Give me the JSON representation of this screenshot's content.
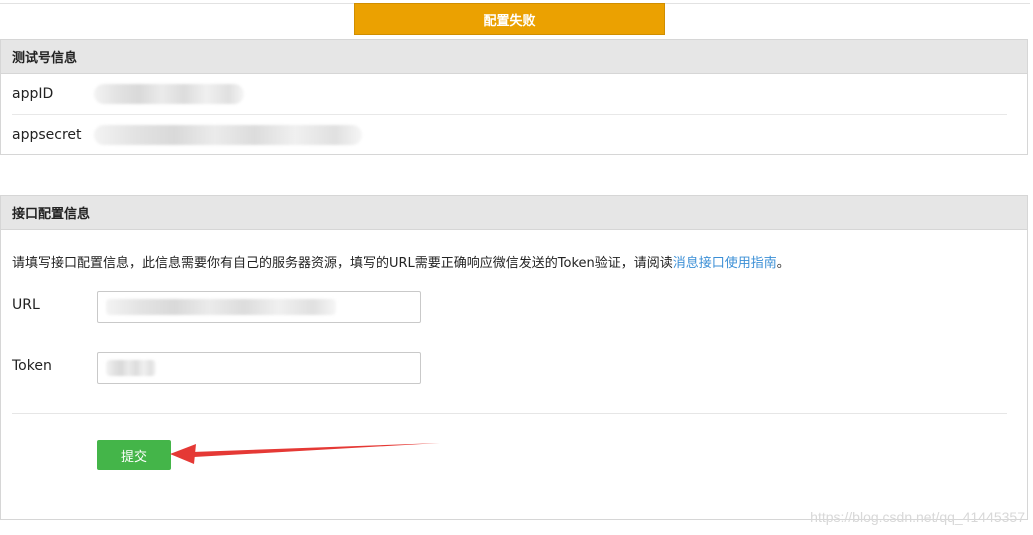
{
  "alert": {
    "text": "配置失败",
    "color": "#eba101"
  },
  "test_account": {
    "title": "测试号信息",
    "appid_label": "appID",
    "appsecret_label": "appsecret"
  },
  "interface_config": {
    "title": "接口配置信息",
    "description": "请填写接口配置信息，此信息需要你有自己的服务器资源，填写的URL需要正确响应微信发送的Token验证，请阅读",
    "doc_link": "消息接口使用指南",
    "description_end": "。",
    "url_label": "URL",
    "token_label": "Token",
    "submit_label": "提交",
    "submit_color": "#44b549"
  },
  "annotation": {
    "arrow_color": "#e53935"
  },
  "watermark": "https://blog.csdn.net/qq_41445357"
}
